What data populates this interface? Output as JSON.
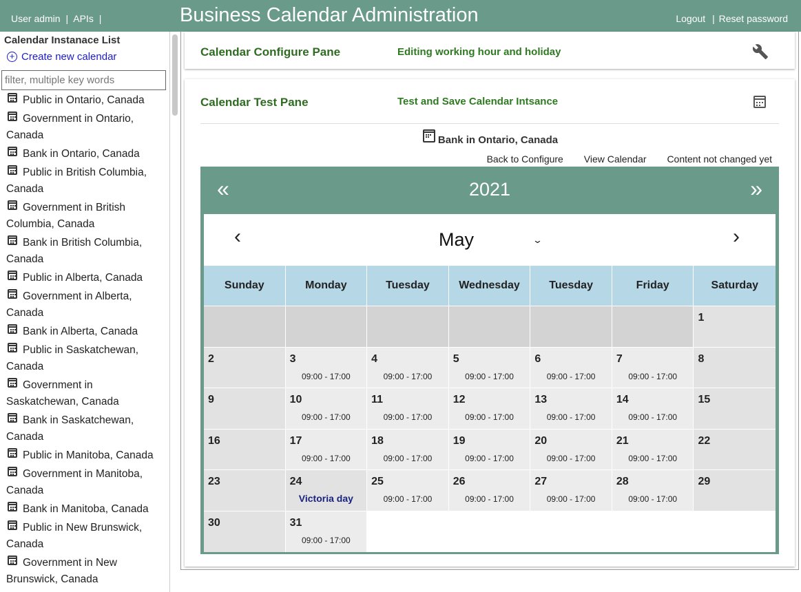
{
  "header": {
    "left_links": [
      "User admin",
      "APIs"
    ],
    "title": "Business Calendar Administration",
    "right_links": [
      "Logout",
      "Reset password"
    ]
  },
  "sidebar": {
    "title": "Calendar Instanace List",
    "create_label": "Create new calendar",
    "filter_placeholder": "filter, multiple key words",
    "items": [
      "Public in Ontario, Canada",
      "Government in Ontario, Canada",
      "Bank in Ontario, Canada",
      "Public in British Columbia, Canada",
      "Government in British Columbia, Canada",
      "Bank in British Columbia, Canada",
      "Public in Alberta, Canada",
      "Government in Alberta, Canada",
      "Bank in Alberta, Canada",
      "Public in Saskatchewan, Canada",
      "Government in Saskatchewan, Canada",
      "Bank in Saskatchewan, Canada",
      "Public in Manitoba, Canada",
      "Government in Manitoba, Canada",
      "Bank in Manitoba, Canada",
      "Public in New Brunswick, Canada",
      "Government in New Brunswick, Canada"
    ]
  },
  "configure_pane": {
    "title": "Calendar Configure Pane",
    "subtitle": "Editing working hour and holiday",
    "icon": "wrench-icon"
  },
  "test_pane": {
    "title": "Calendar Test Pane",
    "subtitle": "Test and Save Calendar Intsance",
    "icon": "calendar-icon",
    "calendar_name": "Bank in Ontario, Canada",
    "actions": {
      "back": "Back to Configure",
      "view": "View Calendar",
      "status": "Content not changed yet"
    }
  },
  "calendar": {
    "year": "2021",
    "year_prev": "«",
    "year_next": "»",
    "month": "May",
    "month_prev": "‹",
    "month_next": "›",
    "month_chevron": "⌄",
    "weekdays": [
      "Sunday",
      "Monday",
      "Tuesday",
      "Wednesday",
      "Tuesday",
      "Friday",
      "Saturday"
    ],
    "weeks": [
      [
        {
          "type": "blank"
        },
        {
          "type": "blank"
        },
        {
          "type": "blank"
        },
        {
          "type": "blank"
        },
        {
          "type": "blank"
        },
        {
          "type": "blank"
        },
        {
          "day": "1",
          "type": "weekend"
        }
      ],
      [
        {
          "day": "2",
          "type": "weekend"
        },
        {
          "day": "3",
          "type": "work",
          "hours": "09:00 - 17:00"
        },
        {
          "day": "4",
          "type": "work",
          "hours": "09:00 - 17:00"
        },
        {
          "day": "5",
          "type": "work",
          "hours": "09:00 - 17:00"
        },
        {
          "day": "6",
          "type": "work",
          "hours": "09:00 - 17:00"
        },
        {
          "day": "7",
          "type": "work",
          "hours": "09:00 - 17:00"
        },
        {
          "day": "8",
          "type": "weekend"
        }
      ],
      [
        {
          "day": "9",
          "type": "weekend"
        },
        {
          "day": "10",
          "type": "work",
          "hours": "09:00 - 17:00"
        },
        {
          "day": "11",
          "type": "work",
          "hours": "09:00 - 17:00"
        },
        {
          "day": "12",
          "type": "work",
          "hours": "09:00 - 17:00"
        },
        {
          "day": "13",
          "type": "work",
          "hours": "09:00 - 17:00"
        },
        {
          "day": "14",
          "type": "work",
          "hours": "09:00 - 17:00"
        },
        {
          "day": "15",
          "type": "weekend"
        }
      ],
      [
        {
          "day": "16",
          "type": "weekend"
        },
        {
          "day": "17",
          "type": "work",
          "hours": "09:00 - 17:00"
        },
        {
          "day": "18",
          "type": "work",
          "hours": "09:00 - 17:00"
        },
        {
          "day": "19",
          "type": "work",
          "hours": "09:00 - 17:00"
        },
        {
          "day": "20",
          "type": "work",
          "hours": "09:00 - 17:00"
        },
        {
          "day": "21",
          "type": "work",
          "hours": "09:00 - 17:00"
        },
        {
          "day": "22",
          "type": "weekend"
        }
      ],
      [
        {
          "day": "23",
          "type": "weekend"
        },
        {
          "day": "24",
          "type": "hol",
          "holiday": "Victoria day"
        },
        {
          "day": "25",
          "type": "work",
          "hours": "09:00 - 17:00"
        },
        {
          "day": "26",
          "type": "work",
          "hours": "09:00 - 17:00"
        },
        {
          "day": "27",
          "type": "work",
          "hours": "09:00 - 17:00"
        },
        {
          "day": "28",
          "type": "work",
          "hours": "09:00 - 17:00"
        },
        {
          "day": "29",
          "type": "weekend"
        }
      ],
      [
        {
          "day": "30",
          "type": "weekend"
        },
        {
          "day": "31",
          "type": "work",
          "hours": "09:00 - 17:00"
        },
        {
          "type": "empty"
        },
        {
          "type": "empty"
        },
        {
          "type": "empty"
        },
        {
          "type": "empty"
        },
        {
          "type": "empty"
        }
      ]
    ]
  },
  "colors": {
    "header_bg": "#6a9a8a",
    "weekday_bg": "#b6d7e6",
    "pane_title": "#2f6b22",
    "holiday_text": "#1a237e",
    "link_blue": "#1a1ad6"
  }
}
